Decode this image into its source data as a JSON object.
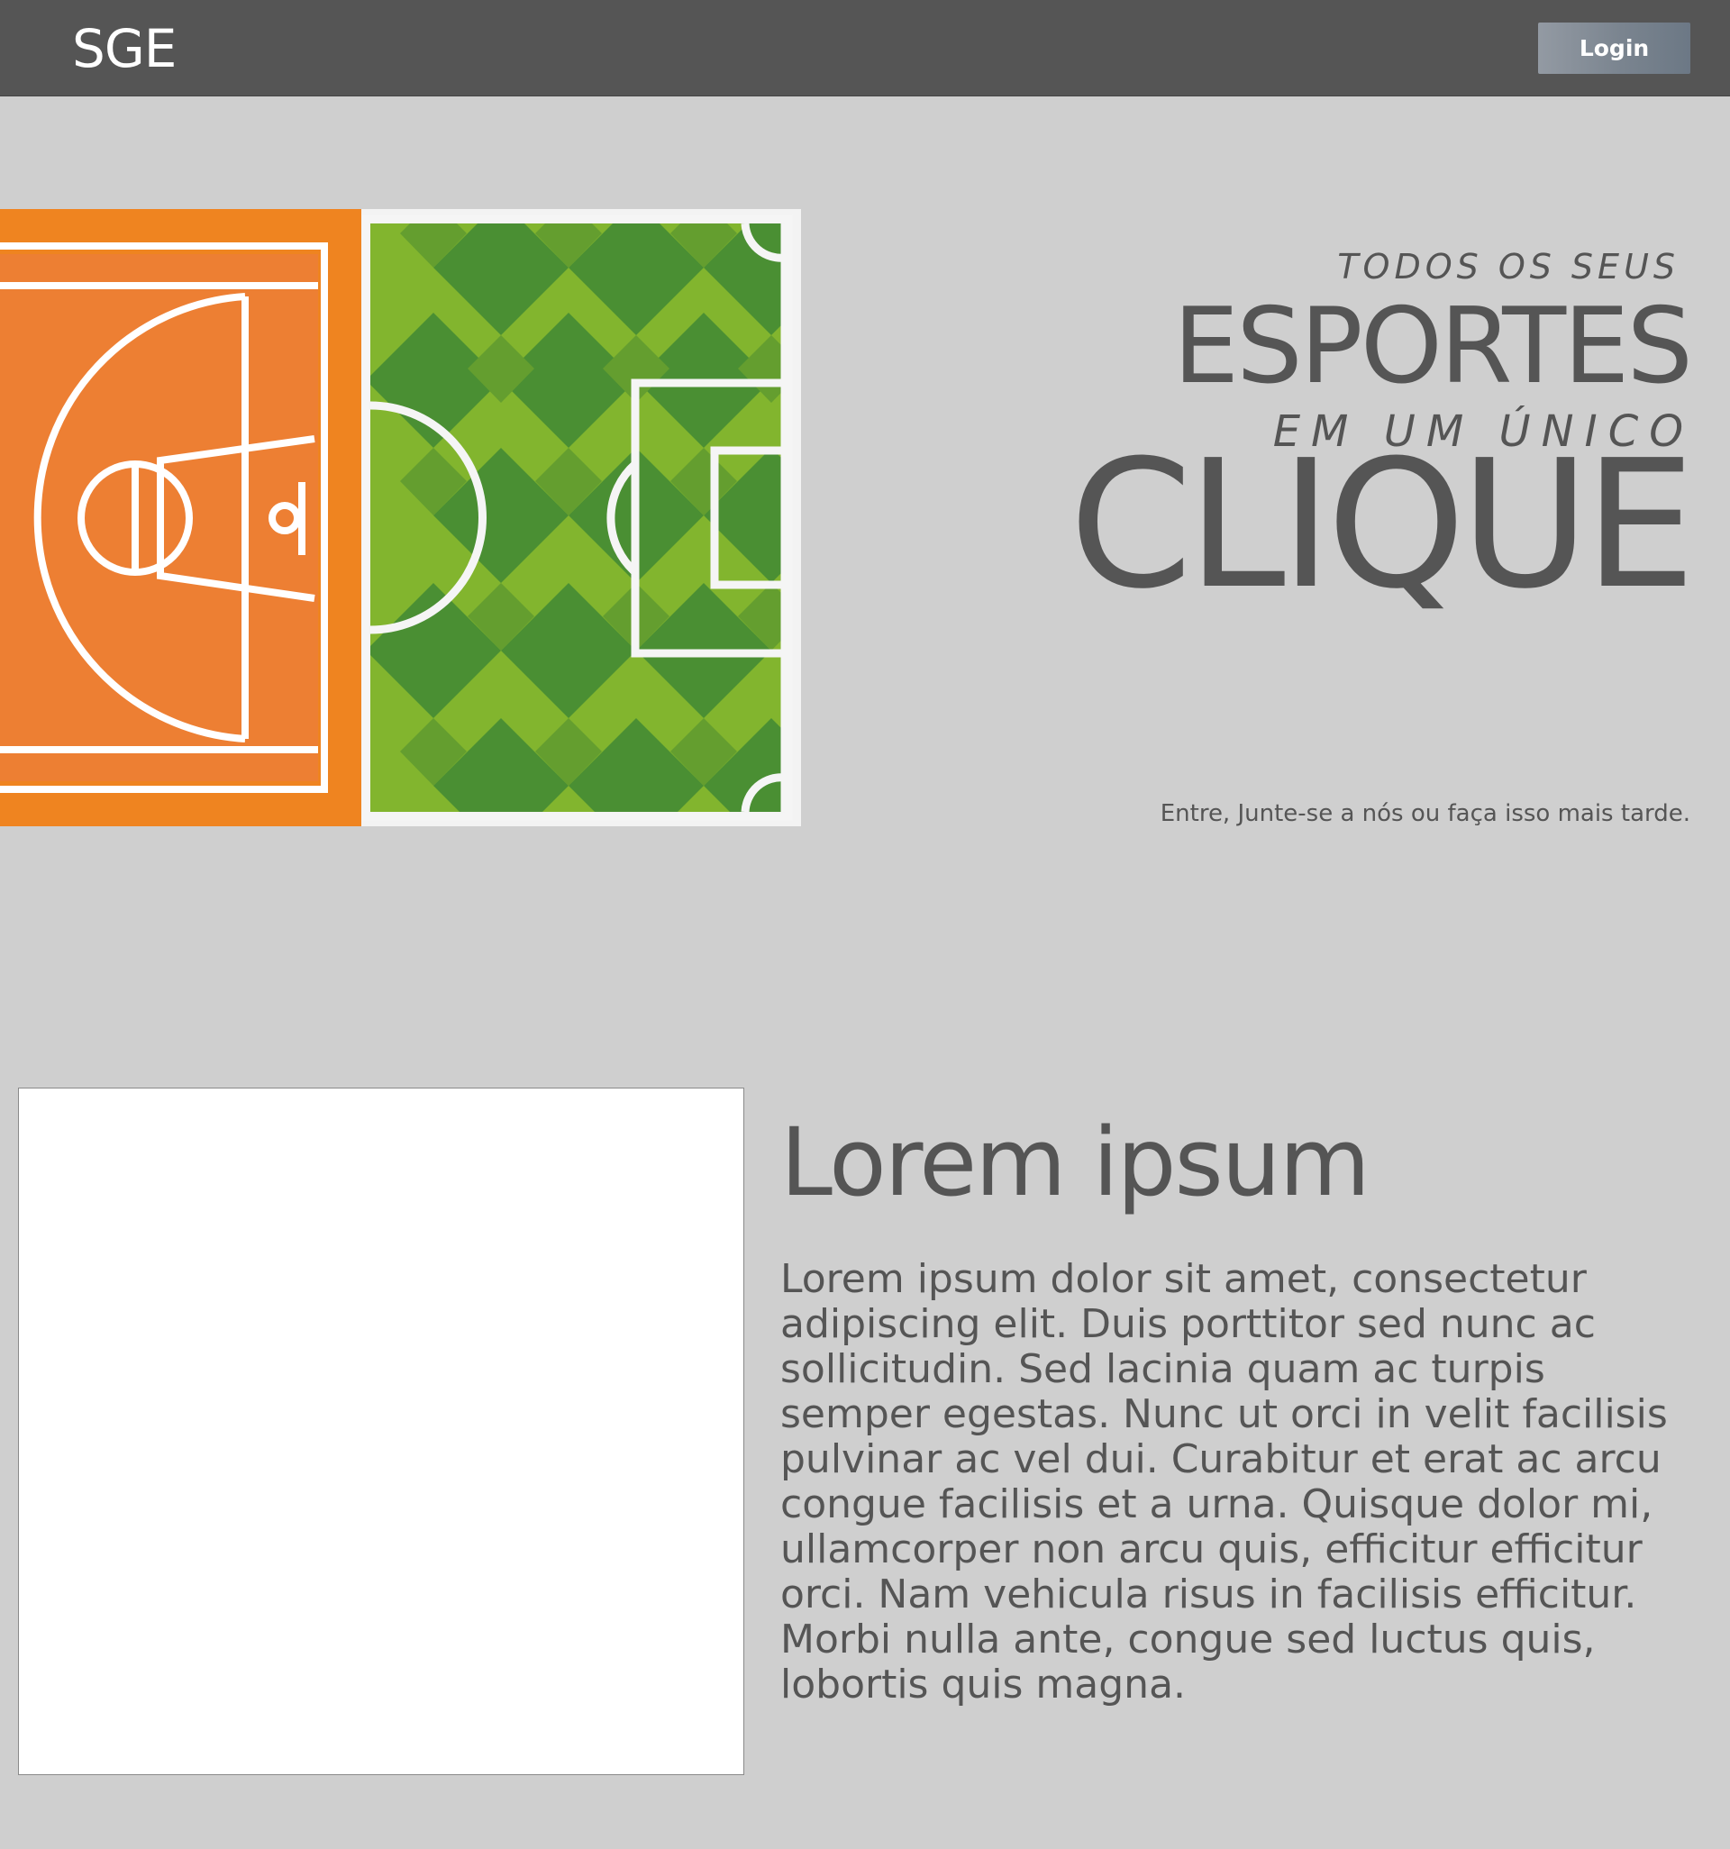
{
  "header": {
    "logo": "SGE",
    "login_label": "Login"
  },
  "hero": {
    "line1": "TODOS OS SEUS",
    "line2": "ESPORTES",
    "line3": "EM UM ÚNICO",
    "line4": "CLIQUE",
    "subtext": "Entre, Junte-se a nós ou faça isso mais tarde.",
    "image": {
      "icon": "sports-courts-illustration",
      "colors": {
        "court_orange": "#ed7f33",
        "court_orange_dark": "#ef8420",
        "field_green_light": "#82b52e",
        "field_green_mid": "#649e2f",
        "field_green_dark": "#4a8f33",
        "lines": "#f5f5f5"
      }
    }
  },
  "content": {
    "title": "Lorem ipsum",
    "body": "Lorem ipsum dolor sit amet, consectetur adipiscing elit. Duis porttitor sed nunc ac sollicitudin. Sed lacinia quam ac turpis semper egestas. Nunc ut orci in velit facilisis pulvinar ac vel dui. Curabitur et erat ac arcu congue facilisis et a urna. Quisque dolor mi, ullamcorper non arcu quis, efficitur efficitur orci. Nam vehicula risus in facilisis efficitur. Morbi nulla ante, congue sed luctus quis, lobortis quis magna."
  },
  "colors": {
    "background": "#cfcfcf",
    "header_bg": "#555555",
    "text": "#555555",
    "login_button": "#7a848f"
  }
}
